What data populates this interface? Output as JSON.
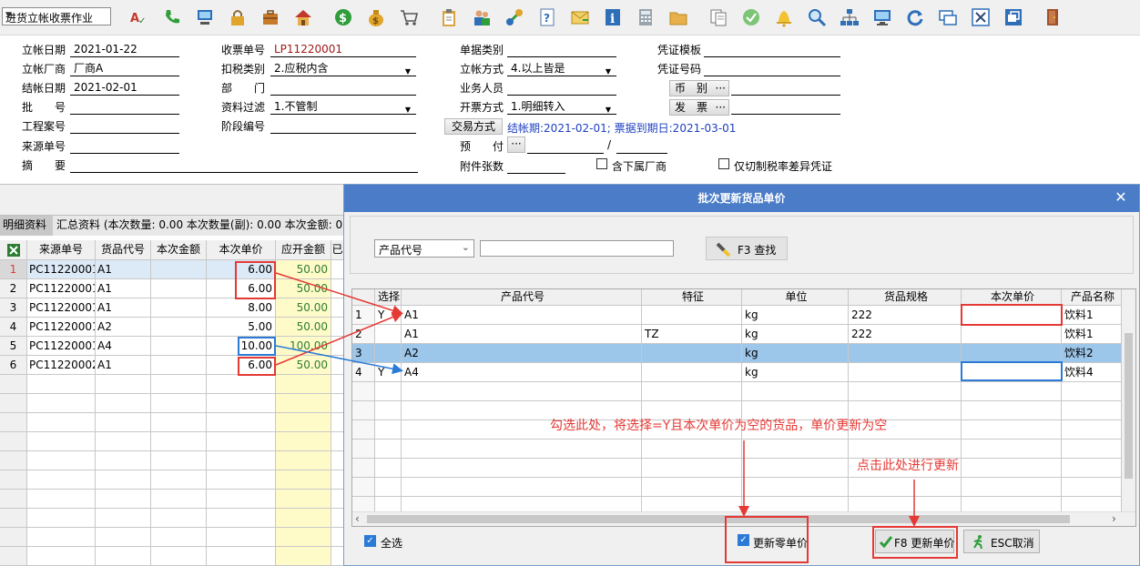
{
  "toolbar": {
    "combo_value": "进货立帐收票作业",
    "icons": [
      "spell-check-icon",
      "phone-icon",
      "computer-icon",
      "lock-icon",
      "briefcase-icon",
      "home-icon",
      "dollar-icon",
      "money-bag-icon",
      "cart-icon",
      "clipboard-icon",
      "users-icon",
      "link-icon",
      "help-doc-icon",
      "mail-icon",
      "info-icon",
      "calculator-icon",
      "folder-icon",
      "copy-icon",
      "check-circle-icon",
      "bell-icon",
      "search-icon",
      "org-chart-icon",
      "monitor-icon",
      "refresh-icon",
      "windows-icon",
      "close-box-icon",
      "restore-icon",
      "exit-door-icon"
    ]
  },
  "form": {
    "post_date_label": "立帐日期",
    "post_date": "2021-01-22",
    "vendor_label": "立帐厂商",
    "vendor": "厂商A",
    "settle_date_label": "结帐日期",
    "settle_date": "2021-02-01",
    "batch_label": "批　　号",
    "project_label": "工程案号",
    "source_no_label": "来源单号",
    "summary_label": "摘　　要",
    "receipt_no_label": "收票单号",
    "receipt_no": "LP11220001",
    "tax_type_label": "扣税类别",
    "tax_type": "2.应税内含",
    "dept_label": "部　　门",
    "filter_label": "资料过滤",
    "filter": "1.不管制",
    "stage_label": "阶段编号",
    "doc_type_label": "单据类别",
    "post_method_label": "立帐方式",
    "post_method": "4.以上皆是",
    "staff_label": "业务人员",
    "invoice_method_label": "开票方式",
    "invoice_method": "1.明细转入",
    "trade_method_btn": "交易方式",
    "trade_info": "结帐期:2021-02-01; 票据到期日:2021-03-01",
    "prepay_label": "预　　付",
    "attach_label": "附件张数",
    "voucher_tpl_label": "凭证模板",
    "voucher_no_label": "凭证号码",
    "currency_btn": "币　别",
    "invoice_btn": "发　票",
    "ellipsis": "···",
    "slash": "/",
    "include_sub_label": "含下属厂商",
    "tax_diff_label": "仅切制税率差异凭证"
  },
  "left_tabs": {
    "detail": "明细资料",
    "summary": "汇总资料 (本次数量: 0.00 本次数量(副): 0.00 本次金额: 0"
  },
  "left_grid": {
    "headers": [
      "来源单号",
      "货品代号",
      "本次金额",
      "本次单价",
      "应开金额",
      "已"
    ],
    "rows": [
      {
        "no": "1",
        "src": "PC11220001",
        "item": "A1",
        "amt": "",
        "price": "6.00",
        "due": "50.00"
      },
      {
        "no": "2",
        "src": "PC11220001",
        "item": "A1",
        "amt": "",
        "price": "6.00",
        "due": "50.00"
      },
      {
        "no": "3",
        "src": "PC11220001",
        "item": "A1",
        "amt": "",
        "price": "8.00",
        "due": "50.00"
      },
      {
        "no": "4",
        "src": "PC11220001",
        "item": "A2",
        "amt": "",
        "price": "5.00",
        "due": "50.00"
      },
      {
        "no": "5",
        "src": "PC11220001",
        "item": "A4",
        "amt": "",
        "price": "10.00",
        "due": "100.00"
      },
      {
        "no": "6",
        "src": "PC11220002",
        "item": "A1",
        "amt": "",
        "price": "6.00",
        "due": "50.00"
      }
    ]
  },
  "dialog": {
    "title": "批次更新货品单价",
    "search_field": "产品代号",
    "search_value": "",
    "find_btn": "F3 查找",
    "headers": [
      "选择",
      "产品代号",
      "特征",
      "单位",
      "货品规格",
      "本次单价",
      "产品名称"
    ],
    "rows": [
      {
        "no": "1",
        "sel": "Y",
        "code": "A1",
        "feat": "",
        "unit": "kg",
        "spec": "222",
        "price": "",
        "name": "饮料1"
      },
      {
        "no": "2",
        "sel": "",
        "code": "A1",
        "feat": "TZ",
        "unit": "kg",
        "spec": "222",
        "price": "",
        "name": "饮料1"
      },
      {
        "no": "3",
        "sel": "",
        "code": "A2",
        "feat": "",
        "unit": "kg",
        "spec": "",
        "price": "",
        "name": "饮料2"
      },
      {
        "no": "4",
        "sel": "Y",
        "code": "A4",
        "feat": "",
        "unit": "kg",
        "spec": "",
        "price": "",
        "name": "饮料4"
      }
    ],
    "select_all": "全选",
    "update_zero": "更新零单价",
    "update_btn": "F8 更新单价",
    "cancel_btn": "ESC取消",
    "annotation1": "勾选此处，将选择=Y且本次单价为空的货品，单价更新为空",
    "annotation2": "点击此处进行更新"
  },
  "colors": {
    "title_bar": "#4a7cc7",
    "annotation": "#e53935",
    "selected_row": "#9cc6ea",
    "highlight_col": "#fffbc8"
  }
}
